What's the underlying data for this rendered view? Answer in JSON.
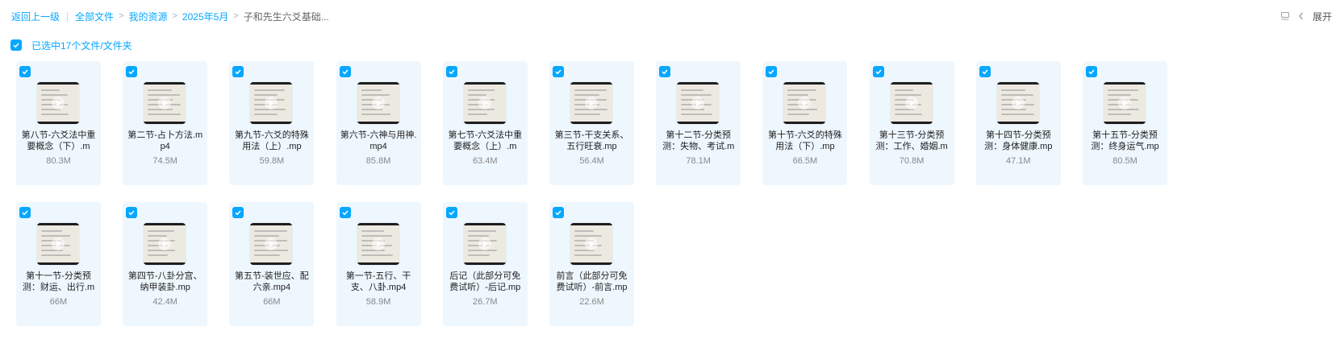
{
  "breadcrumb": {
    "back": "返回上一级",
    "items": [
      "全部文件",
      "我的资源",
      "2025年5月"
    ],
    "current": "子和先生六爻基础...",
    "separator": ">"
  },
  "toolbar": {
    "view_icon": "list-view-icon",
    "collapse_icon": "chevron-left-icon",
    "expand_label": "展开"
  },
  "selection": {
    "label": "已选中17个文件/文件夹",
    "checked": true
  },
  "colors": {
    "accent": "#06a7ff",
    "card_bg": "#eef7fe"
  },
  "files": [
    {
      "name": "第八节-六爻法中重要概念（下）.m",
      "size": "80.3M"
    },
    {
      "name": "第二节-占卜方法.mp4",
      "size": "74.5M"
    },
    {
      "name": "第九节-六爻的特殊用法（上）.mp",
      "size": "59.8M"
    },
    {
      "name": "第六节-六神与用神.mp4",
      "size": "85.8M"
    },
    {
      "name": "第七节-六爻法中重要概念（上）.m",
      "size": "63.4M"
    },
    {
      "name": "第三节-干支关系、五行旺衰.mp",
      "size": "56.4M"
    },
    {
      "name": "第十二节-分类预测：失物、考试.m",
      "size": "78.1M"
    },
    {
      "name": "第十节-六爻的特殊用法（下）.mp",
      "size": "66.5M"
    },
    {
      "name": "第十三节-分类预测：工作、婚姻.m",
      "size": "70.8M"
    },
    {
      "name": "第十四节-分类预测：身体健康.mp",
      "size": "47.1M"
    },
    {
      "name": "第十五节-分类预测：终身运气.mp",
      "size": "80.5M"
    },
    {
      "name": "第十一节-分类预测：财运、出行.m",
      "size": "66M"
    },
    {
      "name": "第四节-八卦分宫、纳甲装卦.mp",
      "size": "42.4M"
    },
    {
      "name": "第五节-装世应、配六亲.mp4",
      "size": "66M"
    },
    {
      "name": "第一节-五行、干支、八卦.mp4",
      "size": "58.9M"
    },
    {
      "name": "后记（此部分可免费试听）-后记.mp",
      "size": "26.7M"
    },
    {
      "name": "前言（此部分可免费试听）-前言.mp",
      "size": "22.6M"
    }
  ]
}
